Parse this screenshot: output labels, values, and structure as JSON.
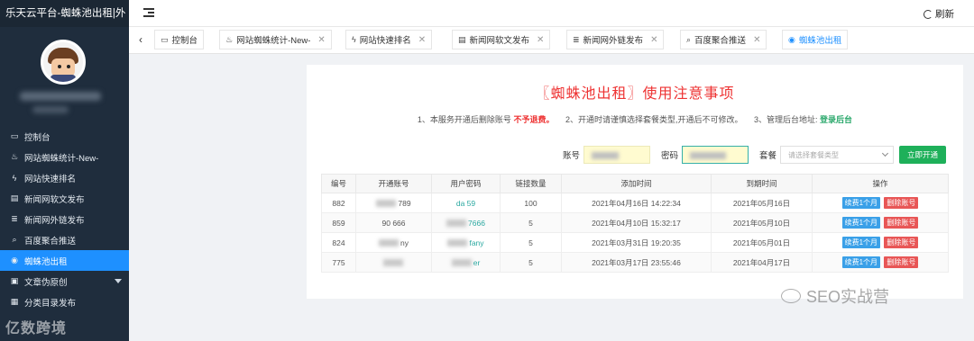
{
  "app": {
    "brand": "乐天云平台-蜘蛛池出租|外"
  },
  "topbar": {
    "refresh_label": "刷新"
  },
  "sidebar": {
    "items": [
      {
        "label": "控制台",
        "icon": "dashboard-icon"
      },
      {
        "label": "网站蜘蛛统计-New-",
        "icon": "spider-icon"
      },
      {
        "label": "网站快速排名",
        "icon": "bolt-icon"
      },
      {
        "label": "新闻网软文发布",
        "icon": "newspaper-icon"
      },
      {
        "label": "新闻网外链发布",
        "icon": "list-icon"
      },
      {
        "label": "百度聚合推送",
        "icon": "search-icon"
      },
      {
        "label": "蜘蛛池出租",
        "icon": "signal-icon",
        "active": true
      },
      {
        "label": "文章伪原创",
        "icon": "document-icon",
        "expandable": true
      },
      {
        "label": "分类目录发布",
        "icon": "folder-icon"
      }
    ],
    "watermark": "亿数跨境"
  },
  "tabs": [
    {
      "label": "控制台",
      "icon": "dashboard-icon",
      "closable": false
    },
    {
      "label": "网站蜘蛛统计-New-",
      "icon": "spider-icon",
      "closable": true
    },
    {
      "label": "网站快速排名",
      "icon": "bolt-icon",
      "closable": true
    },
    {
      "label": "新闻网软文发布",
      "icon": "newspaper-icon",
      "closable": true
    },
    {
      "label": "新闻网外链发布",
      "icon": "list-icon",
      "closable": true
    },
    {
      "label": "百度聚合推送",
      "icon": "search-icon",
      "closable": true
    },
    {
      "label": "蜘蛛池出租",
      "icon": "signal-icon",
      "closable": false,
      "active": true
    }
  ],
  "main": {
    "title": "〖蜘蛛池出租〗使用注意事项",
    "notice": {
      "item1_prefix": "1、本服务开通后删除账号",
      "item1_emph": "不予退费。",
      "item2": "2、开通时请谨慎选择套餐类型,开通后不可修改。",
      "item3_prefix": "3、管理后台地址:",
      "item3_link": "登录后台"
    },
    "form": {
      "account_label": "账号",
      "password_label": "密码",
      "package_label": "套餐",
      "package_placeholder": "请选择套餐类型",
      "submit_label": "立即开通"
    },
    "table": {
      "headers": [
        "编号",
        "开通账号",
        "用户密码",
        "链接数量",
        "添加时间",
        "到期时间",
        "操作"
      ],
      "rows": [
        {
          "id": "882",
          "account": "789",
          "password": "da 59",
          "links": "100",
          "added": "2021年04月16日 14:22:34",
          "expires": "2021年05月16日"
        },
        {
          "id": "859",
          "account": "90 666",
          "password": "7666",
          "links": "5",
          "added": "2021年04月10日 15:32:17",
          "expires": "2021年05月10日"
        },
        {
          "id": "824",
          "account": "ny",
          "password": "fany",
          "links": "5",
          "added": "2021年03月31日 19:20:35",
          "expires": "2021年05月01日"
        },
        {
          "id": "775",
          "account": "",
          "password": "er",
          "links": "5",
          "added": "2021年03月17日 23:55:46",
          "expires": "2021年04月17日"
        }
      ],
      "renew_label": "续费1个月",
      "delete_label": "删除账号"
    }
  },
  "watermark_right": "SEO实战营"
}
